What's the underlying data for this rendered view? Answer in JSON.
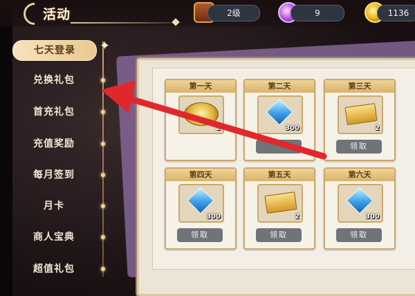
{
  "header": {
    "title": "活动",
    "level": {
      "icon": "treasure-chest-icon",
      "value": "2级"
    },
    "gems": {
      "icon": "purple-gem-icon",
      "value": "9"
    },
    "coins": {
      "icon": "gold-coin-icon",
      "value": "1136"
    }
  },
  "sidebar": {
    "items": [
      {
        "label": "七天登录",
        "active": true
      },
      {
        "label": "兑换礼包",
        "active": false
      },
      {
        "label": "首充礼包",
        "active": false
      },
      {
        "label": "充值奖励",
        "active": false
      },
      {
        "label": "每月签到",
        "active": false
      },
      {
        "label": "月卡",
        "active": false
      },
      {
        "label": "商人宝典",
        "active": false
      },
      {
        "label": "超值礼包",
        "active": false
      }
    ]
  },
  "rewards": {
    "days": [
      {
        "day": "第一天",
        "item": "coupon-icon",
        "qty": "2",
        "claim": ""
      },
      {
        "day": "第二天",
        "item": "diamond-icon",
        "qty": "300",
        "claim": ""
      },
      {
        "day": "第三天",
        "item": "ticket-icon",
        "qty": "2",
        "claim": "领取"
      },
      {
        "day": "第四天",
        "item": "diamond-icon",
        "qty": "300",
        "claim": "领取"
      },
      {
        "day": "第五天",
        "item": "ticket-icon",
        "qty": "2",
        "claim": "领取"
      },
      {
        "day": "第六天",
        "item": "diamond-icon",
        "qty": "300",
        "claim": "领取"
      }
    ]
  },
  "colors": {
    "annotation_arrow": "#e0282c",
    "active_tab": "#f6e2be",
    "claim_button": "#6f7478"
  }
}
